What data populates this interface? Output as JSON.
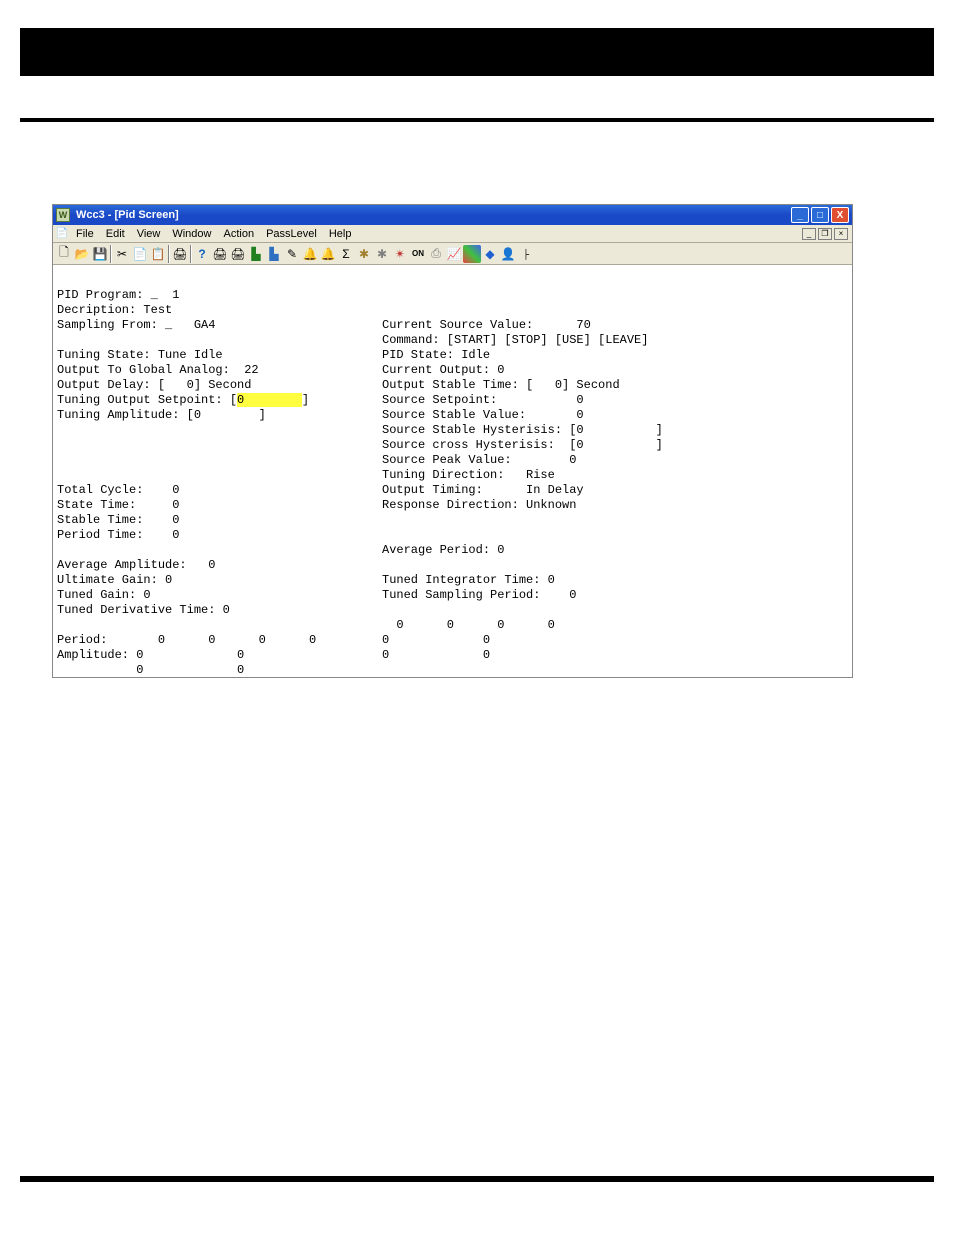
{
  "window": {
    "title": "Wcc3 - [Pid Screen]"
  },
  "menu": {
    "items": [
      "File",
      "Edit",
      "View",
      "Window",
      "Action",
      "PassLevel",
      "Help"
    ]
  },
  "left": {
    "pid_program_label": "PID Program: _  1",
    "description_label": "Decription: Test",
    "sampling_label": "Sampling From: _   GA4",
    "tuning_state_label": "Tuning State: Tune Idle",
    "output_global_label": "Output To Global Analog:  22",
    "output_delay_label": "Output Delay: [   0] Second",
    "tuning_setpoint_pre": "Tuning Output Setpoint: [",
    "tuning_setpoint_val": "0        ",
    "tuning_setpoint_post": "]",
    "tuning_amplitude_label": "Tuning Amplitude: [0        ]",
    "total_cycle_label": "Total Cycle:    0",
    "state_time_label": "State Time:     0",
    "stable_time_label": "Stable Time:    0",
    "period_time_label": "Period Time:    0",
    "avg_amplitude_label": "Average Amplitude:   0",
    "ultimate_gain_label": "Ultimate Gain: 0",
    "tuned_gain_label": "Tuned Gain: 0",
    "tuned_deriv_label": "Tuned Derivative Time: 0",
    "period_row": "Period:       0      0      0      0",
    "amplitude_row": "Amplitude: 0             0",
    "extra_row": "           0             0"
  },
  "right": {
    "cur_src_label": "Current Source Value:      70",
    "command_label": "Command: [START] [STOP] [USE] [LEAVE]",
    "pid_state_label": "PID State: Idle",
    "cur_output_label": "Current Output: 0",
    "output_stable_label": "Output Stable Time: [   0] Second",
    "src_setpoint_label": "Source Setpoint:           0",
    "src_stable_val_label": "Source Stable Value:       0",
    "src_stable_hys_label": "Source Stable Hysterisis: [0          ]",
    "src_cross_hys_label": "Source cross Hysterisis:  [0          ]",
    "src_peak_label": "Source Peak Value:        0",
    "tuning_dir_label": "Tuning Direction:   Rise",
    "output_timing_label": "Output Timing:      In Delay",
    "resp_dir_label": "Response Direction: Unknown",
    "avg_period_label": "Average Period: 0",
    "tuned_int_label": "Tuned Integrator Time: 0",
    "tuned_samp_label": "Tuned Sampling Period:    0",
    "period_row_r": "  0      0      0      0",
    "amplitude_row_r": "0             0",
    "extra_row_r": "0             0"
  }
}
